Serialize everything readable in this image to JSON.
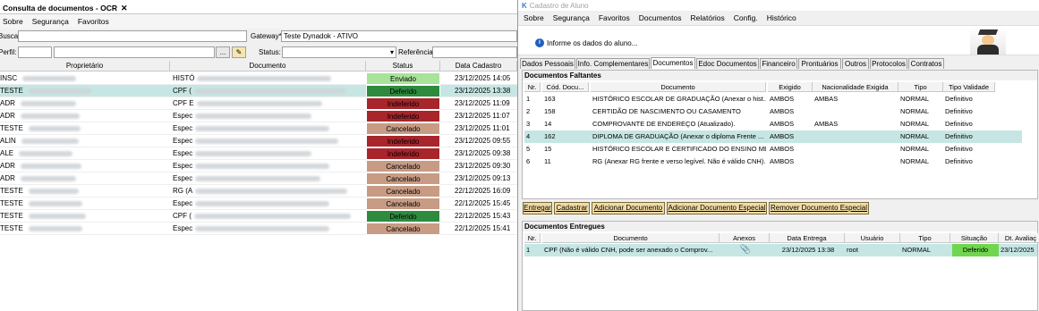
{
  "left": {
    "tab_title": "Consulta de documentos - OCR",
    "close_glyph": "✕",
    "menu": [
      "Sobre",
      "Segurança",
      "Favoritos"
    ],
    "filters": {
      "busca_label": "Busca:",
      "gateway_label": "Gateway*:",
      "gateway_value": "Teste Dynadok - ATIVO",
      "perfil_label": "Perfil:",
      "browse_label": "...",
      "status_label": "Status:",
      "referencia_label": "Referência:"
    },
    "columns": [
      "Proprietário",
      "Documento",
      "Status",
      "Data Cadastro"
    ],
    "rows": [
      {
        "owner": "INSC",
        "doc": "HISTÓ",
        "status": "Enviado",
        "status_color": "#a8e39a",
        "date": "23/12/2025 14:05"
      },
      {
        "owner": "TESTE",
        "doc": "CPF (",
        "status": "Deferido",
        "status_color": "#2e8b3e",
        "date": "23/12/2025 13:38"
      },
      {
        "owner": "ADR",
        "doc": "CPF E",
        "status": "Indeferido",
        "status_color": "#a8252c",
        "date": "23/12/2025 11:09"
      },
      {
        "owner": "ADR",
        "doc": "Espec",
        "status": "Indeferido",
        "status_color": "#a8252c",
        "date": "23/12/2025 11:07"
      },
      {
        "owner": "TESTE",
        "doc": "Espec",
        "status": "Cancelado",
        "status_color": "#c79b84",
        "date": "23/12/2025 11:01"
      },
      {
        "owner": "ALIN",
        "doc": "Espec",
        "status": "Indeferido",
        "status_color": "#a8252c",
        "date": "23/12/2025 09:55"
      },
      {
        "owner": "ALE",
        "doc": "Espec",
        "status": "Indeferido",
        "status_color": "#a8252c",
        "date": "23/12/2025 09:38"
      },
      {
        "owner": "ADR",
        "doc": "Espec",
        "status": "Cancelado",
        "status_color": "#c79b84",
        "date": "23/12/2025 09:30"
      },
      {
        "owner": "ADR",
        "doc": "Espec",
        "status": "Cancelado",
        "status_color": "#c79b84",
        "date": "23/12/2025 09:13"
      },
      {
        "owner": "TESTE",
        "doc": "RG (A",
        "status": "Cancelado",
        "status_color": "#c79b84",
        "date": "22/12/2025 16:09"
      },
      {
        "owner": "TESTE",
        "doc": "Espec",
        "status": "Cancelado",
        "status_color": "#c79b84",
        "date": "22/12/2025 15:45"
      },
      {
        "owner": "TESTE",
        "doc": "CPF (",
        "status": "Deferido",
        "status_color": "#2e8b3e",
        "date": "22/12/2025 15:43"
      },
      {
        "owner": "TESTE",
        "doc": "Espec",
        "status": "Cancelado",
        "status_color": "#c79b84",
        "date": "22/12/2025 15:41"
      }
    ]
  },
  "right": {
    "window_title": "Cadastro de Aluno",
    "menu": [
      "Sobre",
      "Segurança",
      "Favoritos",
      "Documentos",
      "Relatórios",
      "Config.",
      "Histórico"
    ],
    "info_text": "Informe os dados do aluno...",
    "tabs": [
      "Dados Pessoais",
      "Info. Complementares",
      "Documentos",
      "Edoc Documentos",
      "Financeiro",
      "Prontuários",
      "Outros",
      "Protocolos",
      "Contratos"
    ],
    "active_tab": "Documentos",
    "faltantes": {
      "title": "Documentos Faltantes",
      "columns": [
        "Nr.",
        "Cód. Docu...",
        "Documento",
        "Exigido",
        "Nacionalidade Exigida",
        "Tipo",
        "Tipo Validade"
      ],
      "rows": [
        {
          "nr": "1",
          "cod": "163",
          "doc": "HISTÓRICO ESCOLAR DE GRADUAÇÃO (Anexar o hist...",
          "exig": "AMBOS",
          "nac": "AMBAS",
          "tipo": "NORMAL",
          "val": "Definitivo"
        },
        {
          "nr": "2",
          "cod": "158",
          "doc": "CERTIDÃO DE NASCIMENTO OU CASAMENTO",
          "exig": "AMBOS",
          "nac": "",
          "tipo": "NORMAL",
          "val": "Definitivo"
        },
        {
          "nr": "3",
          "cod": "14",
          "doc": "COMPROVANTE DE ENDEREÇO (Atualizado).",
          "exig": "AMBOS",
          "nac": "AMBAS",
          "tipo": "NORMAL",
          "val": "Definitivo"
        },
        {
          "nr": "4",
          "cod": "162",
          "doc": "DIPLOMA DE GRADUAÇÃO (Anexar o diploma Frente ...",
          "exig": "AMBOS",
          "nac": "",
          "tipo": "NORMAL",
          "val": "Definitivo"
        },
        {
          "nr": "5",
          "cod": "15",
          "doc": "HISTÓRICO ESCOLAR E CERTIFICADO DO ENSINO MÉ...",
          "exig": "AMBOS",
          "nac": "",
          "tipo": "NORMAL",
          "val": "Definitivo"
        },
        {
          "nr": "6",
          "cod": "11",
          "doc": "RG (Anexar RG frente e verso legível. Não é válido CNH).",
          "exig": "AMBOS",
          "nac": "",
          "tipo": "NORMAL",
          "val": "Definitivo"
        }
      ]
    },
    "buttons": [
      "Entregar",
      "Cadastrar",
      "Adicionar Documento",
      "Adicionar Documento Especial",
      "Remover Documento Especial"
    ],
    "entregues": {
      "title": "Documentos Entregues",
      "columns": [
        "Nr.",
        "Documento",
        "Anexos",
        "Data Entrega",
        "Usuário",
        "Tipo",
        "Situação",
        "Dt. Avaliaç"
      ],
      "rows": [
        {
          "nr": "1",
          "doc": "CPF (Não é válido CNH, pode ser anexado o Comprov...",
          "anexo_icon": "paperclip-icon",
          "data": "23/12/2025 13:38",
          "user": "root",
          "tipo": "NORMAL",
          "sit": "Deferido",
          "sit_color": "#6fd64e",
          "dt": "23/12/2025"
        }
      ]
    }
  }
}
